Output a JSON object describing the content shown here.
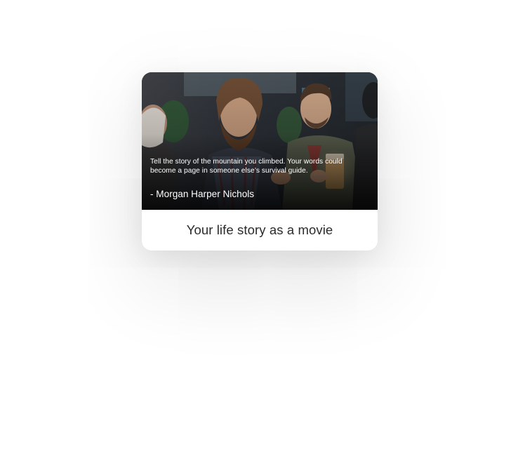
{
  "card": {
    "quote": "Tell the story of the mountain you climbed. Your words could become a page in someone else’s survival guide.",
    "author": "- Morgan Harper Nichols",
    "caption": "Your life story as a movie"
  }
}
